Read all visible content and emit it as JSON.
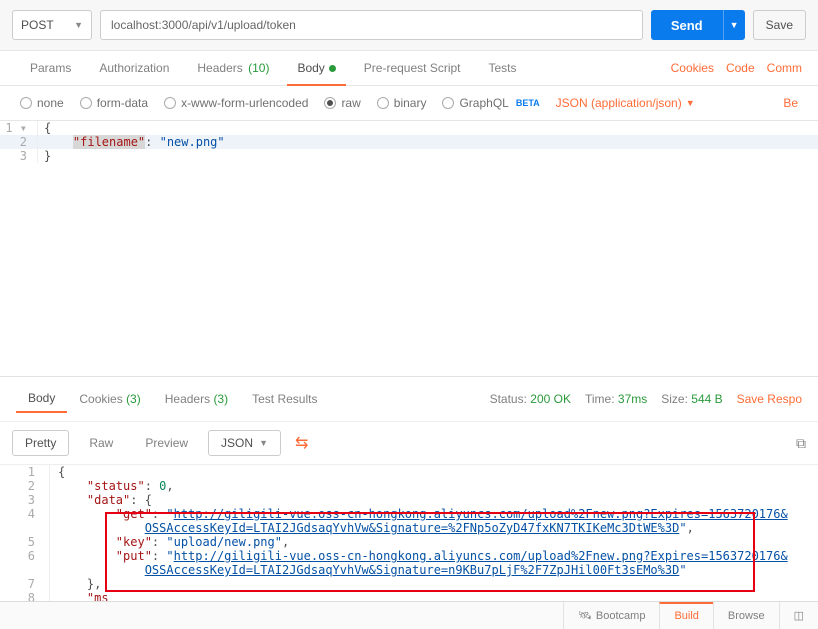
{
  "toolbar": {
    "method": "POST",
    "url": "localhost:3000/api/v1/upload/token",
    "send_label": "Send",
    "save_label": "Save"
  },
  "req_tabs": {
    "params": "Params",
    "authorization": "Authorization",
    "headers": "Headers",
    "headers_count": "(10)",
    "body": "Body",
    "prerequest": "Pre-request Script",
    "tests": "Tests"
  },
  "right_links": {
    "cookies": "Cookies",
    "code": "Code",
    "comments": "Comm"
  },
  "body_types": {
    "none": "none",
    "formdata": "form-data",
    "xwww": "x-www-form-urlencoded",
    "raw": "raw",
    "binary": "binary",
    "graphql": "GraphQL",
    "beta": "BETA",
    "content_type": "JSON (application/json)"
  },
  "trailing": "Be",
  "request_body": {
    "l1": "{",
    "l2_key": "\"filename\"",
    "l2_sep": ": ",
    "l2_val": "\"new.png\"",
    "l3": "}"
  },
  "resp_tabs": {
    "body": "Body",
    "cookies": "Cookies",
    "cookies_count": "(3)",
    "headers": "Headers",
    "headers_count": "(3)",
    "tests": "Test Results"
  },
  "status": {
    "status_lbl": "Status:",
    "status_val": "200 OK",
    "time_lbl": "Time:",
    "time_val": "37ms",
    "size_lbl": "Size:",
    "size_val": "544 B",
    "save": "Save Respo"
  },
  "resp_tools": {
    "pretty": "Pretty",
    "raw": "Raw",
    "preview": "Preview",
    "json": "JSON"
  },
  "response": {
    "l1": "{",
    "l2_k": "\"status\"",
    "l2_v": "0",
    "l3_k": "\"data\"",
    "l3_v": "{",
    "l4_k": "\"get\"",
    "l4_link": "http://giligili-vue.oss-cn-hongkong.aliyuncs.com/upload%2Fnew.png?Expires=1563720176&",
    "l4b_link": "OSSAccessKeyId=LTAI2JGdsaqYvhVw&Signature=%2FNp5oZyD47fxKN7TKIKeMc3DtWE%3D",
    "l5_k": "\"key\"",
    "l5_v": "\"upload/new.png\"",
    "l6_k": "\"put\"",
    "l6_link": "http://giligili-vue.oss-cn-hongkong.aliyuncs.com/upload%2Fnew.png?Expires=1563720176&",
    "l6b_link": "OSSAccessKeyId=LTAI2JGdsaqYvhVw&Signature=n9KBu7pLjF%2F7ZpJHil00Ft3sEMo%3D",
    "l7": "},",
    "l8_k": "\"ms"
  },
  "footer": {
    "bootcamp": "Bootcamp",
    "build": "Build",
    "browse": "Browse"
  }
}
